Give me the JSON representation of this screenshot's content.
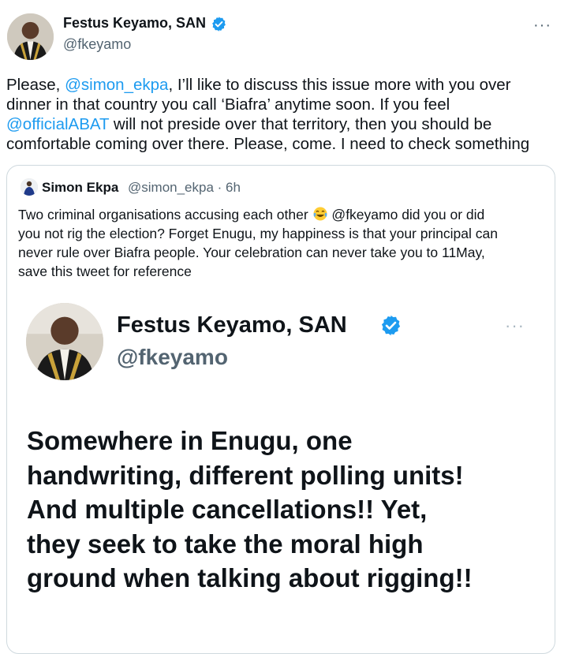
{
  "tweet": {
    "author_name": "Festus Keyamo, SAN",
    "author_handle": "@fkeyamo",
    "more_label": "···",
    "text_line1_a": "Please, ",
    "mention1": "@simon_ekpa",
    "text_line1_b": ", I’ll like to discuss this issue more with you over",
    "text_line2": "dinner in that country you call ‘Biafra’ anytime soon. If you feel",
    "mention2": "@officialABAT",
    "text_line3_b": " will not preside over that territory, then you should be",
    "text_line4": "comfortable coming over there. Please, come. I need to check something"
  },
  "quote": {
    "author_name": "Simon Ekpa",
    "meta": "@simon_ekpa · 6h",
    "line1_a": "Two criminal organisations accusing each other ",
    "line1_b": " @fkeyamo did you or did",
    "line2": "you not rig the election? Forget Enugu, my happiness is that your principal can",
    "line3": "never rule over Biafra people. Your celebration can never take you to 11May,",
    "line4": "save this tweet for reference",
    "emoji_name": "tears-of-joy-emoji"
  },
  "image": {
    "author_name": "Festus Keyamo, SAN",
    "author_handle": "@fkeyamo",
    "more_label": "···",
    "text": "Somewhere in Enugu, one\nhandwriting, different polling units!\nAnd multiple cancellations!! Yet,\nthey seek to take the moral high\nground when talking about rigging!!"
  },
  "colors": {
    "link": "#1d9bf0",
    "verified": "#1d9bf0",
    "secondary_text": "#536471",
    "border": "#cfd9de"
  }
}
